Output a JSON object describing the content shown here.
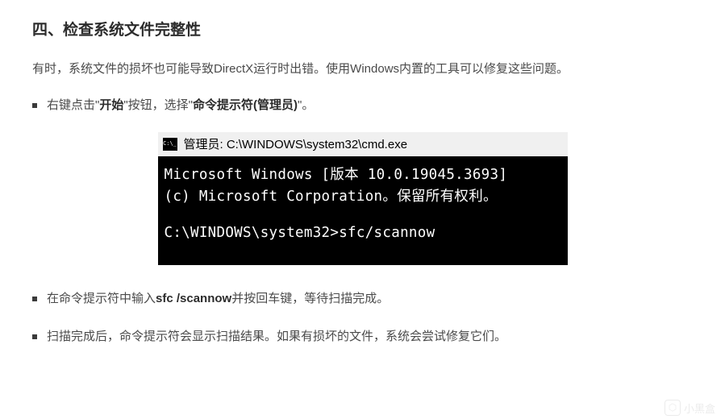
{
  "heading": "四、检查系统文件完整性",
  "intro": "有时，系统文件的损坏也可能导致DirectX运行时出错。使用Windows内置的工具可以修复这些问题。",
  "bullets": {
    "b1_pre": "右键点击\"",
    "b1_bold1": "开始",
    "b1_mid": "\"按钮，选择\"",
    "b1_bold2": "命令提示符(管理员)",
    "b1_post": "\"。",
    "b2_pre": "在命令提示符中输入",
    "b2_bold": "sfc /scannow",
    "b2_post": "并按回车键，等待扫描完成。",
    "b3": "扫描完成后，命令提示符会显示扫描结果。如果有损坏的文件，系统会尝试修复它们。"
  },
  "cmd": {
    "title": "管理员: C:\\WINDOWS\\system32\\cmd.exe",
    "line1": "Microsoft Windows [版本 10.0.19045.3693]",
    "line2": "(c) Microsoft Corporation。保留所有权利。",
    "line3": "C:\\WINDOWS\\system32>sfc/scannow"
  },
  "watermark": "小黑盒"
}
